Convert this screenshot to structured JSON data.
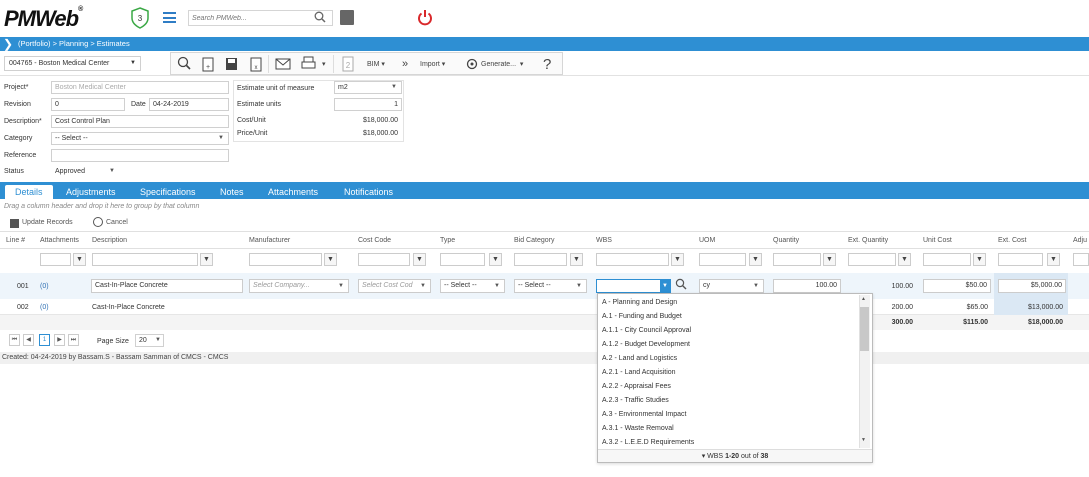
{
  "app": {
    "logo": "PMWeb",
    "reg": "®",
    "badge_count": "3",
    "search_placeholder": "Search PMWeb..."
  },
  "breadcrumb": "(Portfolio) > Planning > Estimates",
  "project_selector": "004765 - Boston Medical Center",
  "toolbar": {
    "bim": "BIM",
    "import": "Import",
    "generate": "Generate...",
    "help": "?"
  },
  "form": {
    "project_label": "Project*",
    "project_value": "Boston Medical Center",
    "revision_label": "Revision",
    "revision_value": "0",
    "date_label": "Date",
    "date_value": "04-24-2019",
    "description_label": "Description*",
    "description_value": "Cost Control Plan",
    "category_label": "Category",
    "category_value": "-- Select --",
    "reference_label": "Reference",
    "reference_value": "",
    "status_label": "Status",
    "status_value": "Approved",
    "uom_label": "Estimate unit of measure",
    "uom_value": "m2",
    "units_label": "Estimate units",
    "units_value": "1",
    "cost_unit_label": "Cost/Unit",
    "cost_unit_value": "$18,000.00",
    "price_unit_label": "Price/Unit",
    "price_unit_value": "$18,000.00"
  },
  "tabs": [
    "Details",
    "Adjustments",
    "Specifications",
    "Notes",
    "Attachments",
    "Notifications"
  ],
  "grid": {
    "drag_hint": "Drag a column header and drop it here to group by that column",
    "update_records": "Update Records",
    "cancel": "Cancel",
    "columns": [
      "Line #",
      "Attachments",
      "Description",
      "Manufacturer",
      "Cost Code",
      "Type",
      "Bid Category",
      "WBS",
      "UOM",
      "Quantity",
      "Ext. Quantity",
      "Unit Cost",
      "Ext. Cost",
      "Adju"
    ],
    "rows": [
      {
        "line": "001",
        "attachments": "(0)",
        "description": "Cast-In-Place Concrete",
        "manufacturer": "Select Company...",
        "cost_code": "Select Cost Cod",
        "type": "-- Select --",
        "bid_category": "-- Select --",
        "wbs": "",
        "uom": "cy",
        "quantity": "100.00",
        "ext_quantity": "100.00",
        "unit_cost": "$50.00",
        "ext_cost": "$5,000.00"
      },
      {
        "line": "002",
        "attachments": "(0)",
        "description": "Cast-In-Place Concrete",
        "ext_quantity": "200.00",
        "unit_cost": "$65.00",
        "ext_cost": "$13,000.00"
      }
    ],
    "totals": {
      "ext_quantity": "300.00",
      "unit_cost": "$115.00",
      "ext_cost": "$18,000.00"
    },
    "page_size_label": "Page Size",
    "page_size": "20",
    "current_page": "1"
  },
  "footer": "Created:  04-24-2019 by Bassam.S - Bassam Samman of CMCS - CMCS",
  "wbs_dropdown": {
    "items": [
      "A - Planning and Design",
      "A.1 - Funding and Budget",
      "A.1.1 - City Council Approval",
      "A.1.2 - Budget Development",
      "A.2 - Land and Logistics",
      "A.2.1 - Land Acquisition",
      "A.2.2 - Appraisal Fees",
      "A.2.3 - Traffic Studies",
      "A.3 - Environmental Impact",
      "A.3.1 - Waste Removal",
      "A.3.2 - L.E.E.D Requirements"
    ],
    "footer_prefix": "WBS",
    "footer_range": "1-20",
    "footer_suffix": "out of",
    "footer_total": "38"
  },
  "colors": {
    "accent": "#2e8fd3",
    "power": "#d9282b"
  }
}
